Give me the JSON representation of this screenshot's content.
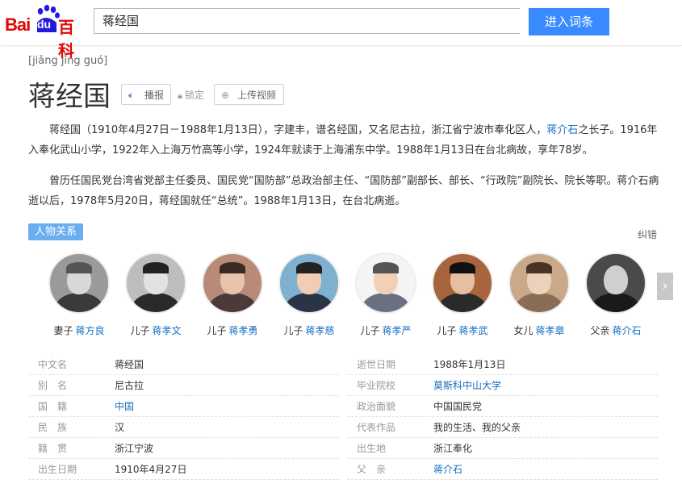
{
  "header": {
    "logo_text_bai": "Bai",
    "logo_text_du": "du",
    "logo_text_baike": "百科",
    "search_value": "蒋经国",
    "search_button": "进入词条"
  },
  "entry": {
    "pinyin": "[jiǎng jīng guó]",
    "title": "蒋经国",
    "btn_broadcast": "播报",
    "lock_label": "锁定",
    "btn_upload": "上传视频"
  },
  "summary": {
    "p1_a": "蒋经国（1910年4月27日－1988年1月13日），字建丰，谱名经国，又名尼古拉，浙江省宁波市奉化区人，",
    "p1_link": "蒋介石",
    "p1_b": "之长子。1916年入奉化武山小学，1922年入上海万竹高等小学，1924年就读于上海浦东中学。1988年1月13日在台北病故，享年78岁。",
    "p2": "曾历任国民党台湾省党部主任委员、国民党“国防部”总政治部主任、“国防部”副部长、部长、“行政院”副院长、院长等职。蒋介石病逝以后，1978年5月20日，蒋经国就任“总统”。1988年1月13日，在台北病逝。"
  },
  "relations": {
    "tag": "人物关系",
    "correct": "纠错",
    "people": [
      {
        "relation": "妻子",
        "name": "蒋方良"
      },
      {
        "relation": "儿子",
        "name": "蒋孝文"
      },
      {
        "relation": "儿子",
        "name": "蒋孝勇"
      },
      {
        "relation": "儿子",
        "name": "蒋孝慈"
      },
      {
        "relation": "儿子",
        "name": "蒋孝严"
      },
      {
        "relation": "儿子",
        "name": "蒋孝武"
      },
      {
        "relation": "女儿",
        "name": "蒋孝章"
      },
      {
        "relation": "父亲",
        "name": "蒋介石"
      }
    ],
    "next_icon": "chevron-right-icon"
  },
  "infobox": {
    "left": [
      {
        "key": "中文名",
        "value": "蒋经国"
      },
      {
        "key": "别　名",
        "value": "尼古拉"
      },
      {
        "key": "国　籍",
        "value": "中国"
      },
      {
        "key": "民　族",
        "value": "汉"
      },
      {
        "key": "籍　贯",
        "value": "浙江宁波"
      },
      {
        "key": "出生日期",
        "value": "1910年4月27日"
      }
    ],
    "right": [
      {
        "key": "逝世日期",
        "value": "1988年1月13日"
      },
      {
        "key": "毕业院校",
        "value": "莫斯科中山大学"
      },
      {
        "key": "政治面貌",
        "value": "中国国民党"
      },
      {
        "key": "代表作品",
        "value": "我的生活、我的父亲"
      },
      {
        "key": "出生地",
        "value": "浙江奉化"
      },
      {
        "key": "父　亲",
        "value": "蒋介石"
      }
    ]
  },
  "colors": {
    "brand_red": "#e10601",
    "accent_blue": "#3a8bff",
    "link_blue": "#136ec2"
  }
}
